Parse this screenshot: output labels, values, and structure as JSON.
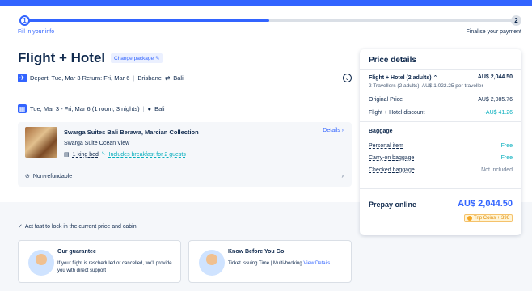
{
  "progress": {
    "step1_number": "1",
    "step1_label": "Fill in your info",
    "step2_number": "2",
    "step2_label": "Finalise your payment"
  },
  "header": {
    "title": "Flight + Hotel",
    "change_package": "Change package"
  },
  "flight": {
    "summary": "Depart: Tue, Mar 3  Return: Fri, Mar 6",
    "from": "Brisbane",
    "to": "Bali"
  },
  "hotel_summary": {
    "dates": "Tue, Mar 3 - Fri, Mar 6  (1 room, 3 nights)",
    "location": "Bali"
  },
  "hotel": {
    "name": "Swarga Suites Bali Berawa, Marcian Collection",
    "room": "Swarga Suite Ocean View",
    "bed": "1 king bed",
    "breakfast": "Includes breakfast for 2 guests",
    "details_link": "Details",
    "policy": "Non-refundable"
  },
  "notice": {
    "act_fast": "Act fast to lock in the current price and cabin"
  },
  "promos": [
    {
      "title": "Our guarantee",
      "text": "If your flight is rescheduled or cancelled, we'll provide you with direct support"
    },
    {
      "title": "Know Before You Go",
      "text": "Ticket Issuing Time | Multi-booking",
      "link": "View Details"
    }
  ],
  "price": {
    "title": "Price details",
    "line_label": "Flight + Hotel  (2 adults)",
    "line_value": "AU$ 2,044.50",
    "travellers": "2 Travellers  (2 adults), AU$ 1,022.25 per traveller",
    "original_label": "Original Price",
    "original_value": "AU$ 2,085.76",
    "discount_label": "Flight + Hotel discount",
    "discount_value": "-AU$ 41.26",
    "baggage_heading": "Baggage",
    "baggage": [
      {
        "label": "Personal item",
        "value": "Free"
      },
      {
        "label": "Carry-on baggage",
        "value": "Free"
      },
      {
        "label": "Checked baggage",
        "value": "Not included"
      }
    ],
    "prepay_label": "Prepay online",
    "prepay_value": "AU$ 2,044.50",
    "coins": "Trip Coins + 396"
  },
  "colors": {
    "accent": "#3264ff",
    "teal": "#06aebd",
    "text": "#0f294d"
  }
}
